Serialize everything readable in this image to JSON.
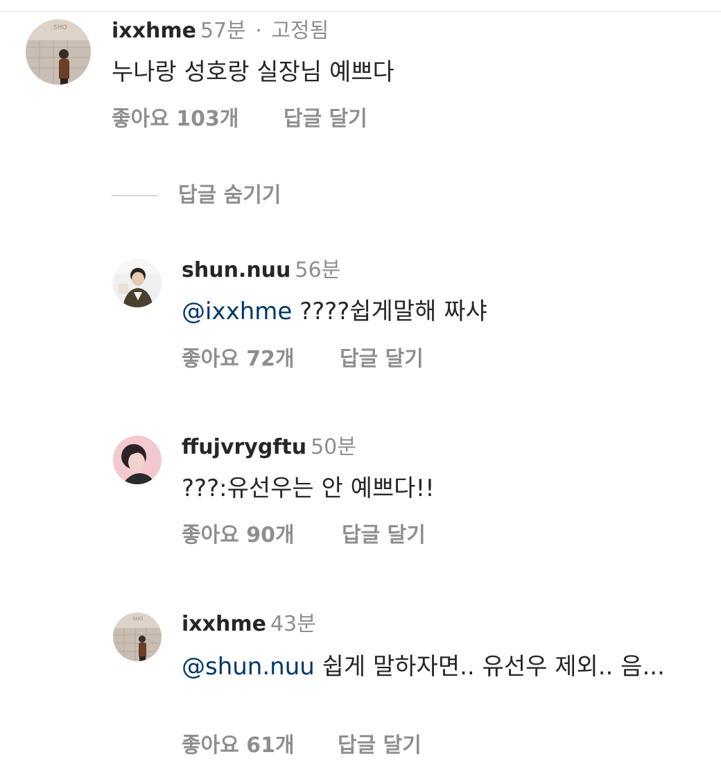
{
  "comments": [
    {
      "username": "ixxhme",
      "time": "57분",
      "separator": "·",
      "status": "고정됨",
      "mention": "",
      "text": "누나랑 성호랑 실장님 예쁘다",
      "likes": "좋아요 103개",
      "reply": "답글 달기",
      "avatar_sign": "SHO"
    },
    {
      "username": "shun.nuu",
      "time": "56분",
      "mention": "@ixxhme",
      "text": " ????쉽게말해 짜샤",
      "likes": "좋아요 72개",
      "reply": "답글 달기"
    },
    {
      "username": "ffujvrygftu",
      "time": "50분",
      "mention": "",
      "text": "???:유선우는 안 예쁘다!!",
      "likes": "좋아요 90개",
      "reply": "답글 달기"
    },
    {
      "username": "ixxhme",
      "time": "43분",
      "mention": "@shun.nuu",
      "text": " 쉽게 말하자면.. 유선우 제외.. 음...",
      "likes": "좋아요 61개",
      "reply": "답글 달기",
      "avatar_sign": "SHO"
    }
  ],
  "hide_replies": {
    "label": "답글 숨기기"
  },
  "colors": {
    "text": "#262626",
    "secondary": "#8e8e8e",
    "mention": "#00376b",
    "divider": "#e3e3e3"
  }
}
